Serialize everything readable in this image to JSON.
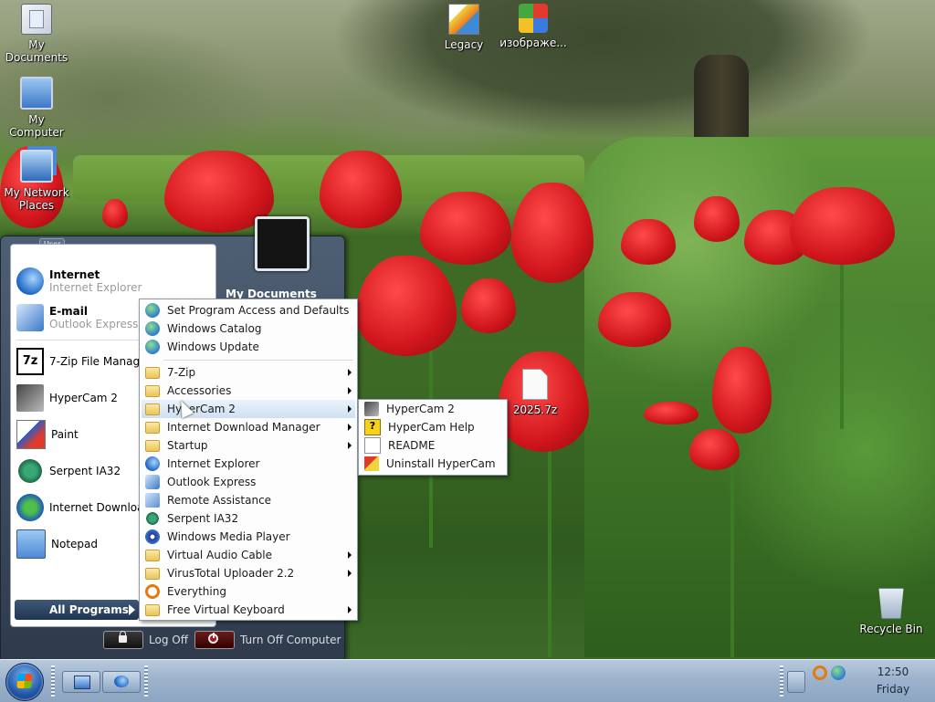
{
  "desktop": {
    "icons": [
      {
        "label_lines": [
          "My",
          "Documents"
        ]
      },
      {
        "label_lines": [
          "My Computer"
        ]
      },
      {
        "label_lines": [
          "My Network",
          "Places"
        ]
      },
      {
        "label_lines": [
          "Legacy"
        ]
      },
      {
        "label_lines": [
          "изображе..."
        ]
      },
      {
        "label_lines": [
          "2025.7z"
        ]
      },
      {
        "label_lines": [
          "Recycle Bin"
        ]
      }
    ]
  },
  "start_menu": {
    "user_tag": "User",
    "pinned": [
      {
        "title": "Internet",
        "subtitle": "Internet Explorer",
        "icon": "internet-explorer-icon"
      },
      {
        "title": "E-mail",
        "subtitle": "Outlook Express",
        "icon": "outlook-express-icon"
      }
    ],
    "recent": [
      {
        "label": "7-Zip File Manager",
        "icon": "7zip-icon"
      },
      {
        "label": "HyperCam 2",
        "icon": "hypercam-icon"
      },
      {
        "label": "Paint",
        "icon": "paint-icon"
      },
      {
        "label": "Serpent IA32",
        "icon": "serpent-icon"
      },
      {
        "label": "Internet Download",
        "icon": "idm-icon"
      },
      {
        "label": "Notepad",
        "icon": "notepad-icon"
      }
    ],
    "all_programs": "All Programs",
    "right_pane": {
      "my_documents": "My Documents"
    },
    "log_off": "Log Off",
    "turn_off": "Turn Off Computer"
  },
  "programs_menu": {
    "top_items": [
      {
        "label": "Set Program Access and Defaults",
        "icon": "defaults-icon"
      },
      {
        "label": "Windows Catalog",
        "icon": "catalog-icon"
      },
      {
        "label": "Windows Update",
        "icon": "update-icon"
      }
    ],
    "items": [
      {
        "label": "7-Zip",
        "icon": "folder-icon",
        "submenu": true
      },
      {
        "label": "Accessories",
        "icon": "folder-icon",
        "submenu": true
      },
      {
        "label": "HyperCam 2",
        "icon": "folder-icon",
        "submenu": true,
        "highlighted": true
      },
      {
        "label": "Internet Download Manager",
        "icon": "folder-icon",
        "submenu": true
      },
      {
        "label": "Startup",
        "icon": "folder-icon",
        "submenu": true
      },
      {
        "label": "Internet Explorer",
        "icon": "internet-explorer-icon",
        "submenu": false
      },
      {
        "label": "Outlook Express",
        "icon": "outlook-express-icon",
        "submenu": false
      },
      {
        "label": "Remote Assistance",
        "icon": "remote-assistance-icon",
        "submenu": false
      },
      {
        "label": "Serpent IA32",
        "icon": "serpent-icon",
        "submenu": false
      },
      {
        "label": "Windows Media Player",
        "icon": "media-player-icon",
        "submenu": false
      },
      {
        "label": "Virtual Audio Cable",
        "icon": "folder-icon",
        "submenu": true
      },
      {
        "label": "VirusTotal Uploader 2.2",
        "icon": "folder-icon",
        "submenu": true
      },
      {
        "label": "Everything",
        "icon": "search-icon",
        "submenu": false
      },
      {
        "label": "Free Virtual Keyboard",
        "icon": "folder-icon",
        "submenu": true
      }
    ]
  },
  "hypercam_submenu": {
    "items": [
      {
        "label": "HyperCam 2",
        "icon": "hypercam-icon"
      },
      {
        "label": "HyperCam Help",
        "icon": "help-icon"
      },
      {
        "label": "README",
        "icon": "readme-icon"
      },
      {
        "label": "Uninstall HyperCam",
        "icon": "uninstall-icon"
      }
    ]
  },
  "taskbar": {
    "clock_time": "12:50",
    "clock_day": "Friday"
  }
}
